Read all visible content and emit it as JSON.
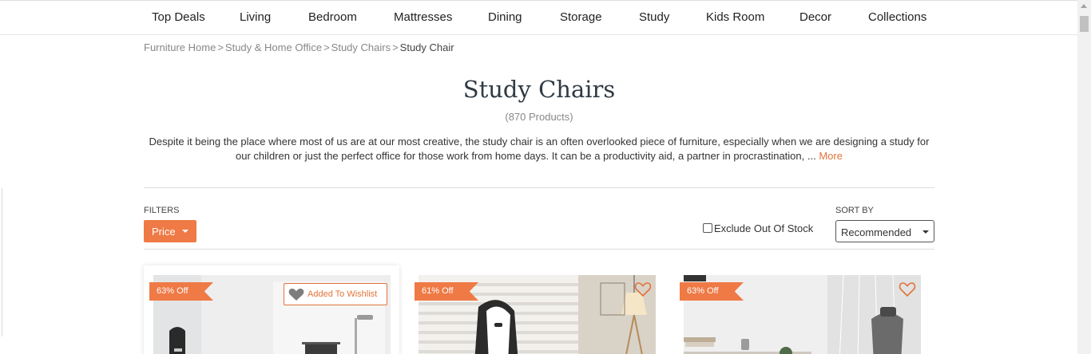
{
  "nav": {
    "items": [
      "Top Deals",
      "Living",
      "Bedroom",
      "Mattresses",
      "Dining",
      "Storage",
      "Study",
      "Kids Room",
      "Decor",
      "Collections"
    ]
  },
  "breadcrumb": {
    "items": [
      "Furniture Home",
      "Study & Home Office",
      "Study Chairs"
    ],
    "separator": ">",
    "current": "Study Chair"
  },
  "category": {
    "title": "Study Chairs",
    "count": "(870 Products)",
    "description": "Despite it being the place where most of us are at our most creative, the study chair is an often overlooked piece of furniture, especially when we are designing a study for our children or just the perfect office for those work from home days. It can be a productivity aid, a partner in procrastination, ...",
    "more_label": "More"
  },
  "toolbar": {
    "filters_label": "FILTERS",
    "price_label": "Price",
    "exclude_label": "Exclude Out Of Stock",
    "exclude_checked": false,
    "sort_label": "SORT BY",
    "sort_value": "Recommended"
  },
  "products": [
    {
      "discount": "63% Off",
      "wishlist_label": "Added To Wishlist",
      "wishlisted": true
    },
    {
      "discount": "61% Off",
      "wishlisted": false
    },
    {
      "discount": "63% Off",
      "wishlisted": false
    }
  ],
  "colors": {
    "accent": "#ef7a45",
    "link": "#e2733a",
    "title": "#2f3a44"
  }
}
